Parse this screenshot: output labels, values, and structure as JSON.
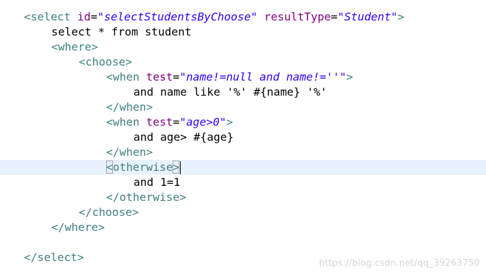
{
  "editor": {
    "current_line": 11,
    "lines": [
      {
        "parts": [
          {
            "t": "tag",
            "s": "<select "
          },
          {
            "t": "attr",
            "s": "id"
          },
          {
            "t": "eq",
            "s": "="
          },
          {
            "t": "val",
            "s": "\"selectStudentsByChoose\""
          },
          {
            "t": "txt",
            "s": " "
          },
          {
            "t": "attr",
            "s": "resultType"
          },
          {
            "t": "eq",
            "s": "="
          },
          {
            "t": "val",
            "s": "\"Student\""
          },
          {
            "t": "tag",
            "s": ">"
          }
        ]
      },
      {
        "parts": [
          {
            "t": "txt",
            "s": "select * from student"
          }
        ]
      },
      {
        "parts": [
          {
            "t": "tag",
            "s": "<where>"
          }
        ]
      },
      {
        "parts": [
          {
            "t": "tag",
            "s": "<choose>"
          }
        ]
      },
      {
        "parts": [
          {
            "t": "tag",
            "s": "<when "
          },
          {
            "t": "attr",
            "s": "test"
          },
          {
            "t": "eq",
            "s": "="
          },
          {
            "t": "val",
            "s": "\"name!=null and name!=''\""
          },
          {
            "t": "tag",
            "s": ">"
          }
        ]
      },
      {
        "parts": [
          {
            "t": "txt",
            "s": "and name like '%' #{name} '%'"
          }
        ]
      },
      {
        "parts": [
          {
            "t": "tag",
            "s": "</when>"
          }
        ]
      },
      {
        "parts": [
          {
            "t": "tag",
            "s": "<when "
          },
          {
            "t": "attr",
            "s": "test"
          },
          {
            "t": "eq",
            "s": "="
          },
          {
            "t": "val",
            "s": "\"age>0\""
          },
          {
            "t": "tag",
            "s": ">"
          }
        ]
      },
      {
        "parts": [
          {
            "t": "txt",
            "s": "and age> #{age}"
          }
        ]
      },
      {
        "parts": [
          {
            "t": "tag",
            "s": "</when>"
          }
        ]
      },
      {
        "parts": [
          {
            "t": "bracket",
            "s": "<"
          },
          {
            "t": "tag",
            "s": "otherwise"
          },
          {
            "t": "bracket",
            "s": ">"
          },
          {
            "t": "caret",
            "s": ""
          }
        ]
      },
      {
        "parts": [
          {
            "t": "txt",
            "s": "and 1=1"
          }
        ]
      },
      {
        "parts": [
          {
            "t": "tag",
            "s": "</otherwise>"
          }
        ]
      },
      {
        "parts": [
          {
            "t": "tag",
            "s": "</choose>"
          }
        ]
      },
      {
        "parts": [
          {
            "t": "tag",
            "s": "</where>"
          }
        ]
      },
      {
        "parts": []
      },
      {
        "parts": [
          {
            "t": "tag",
            "s": "</select>"
          }
        ]
      }
    ]
  },
  "watermark": {
    "text": "https://blog.csdn.net/qq_39263750"
  }
}
